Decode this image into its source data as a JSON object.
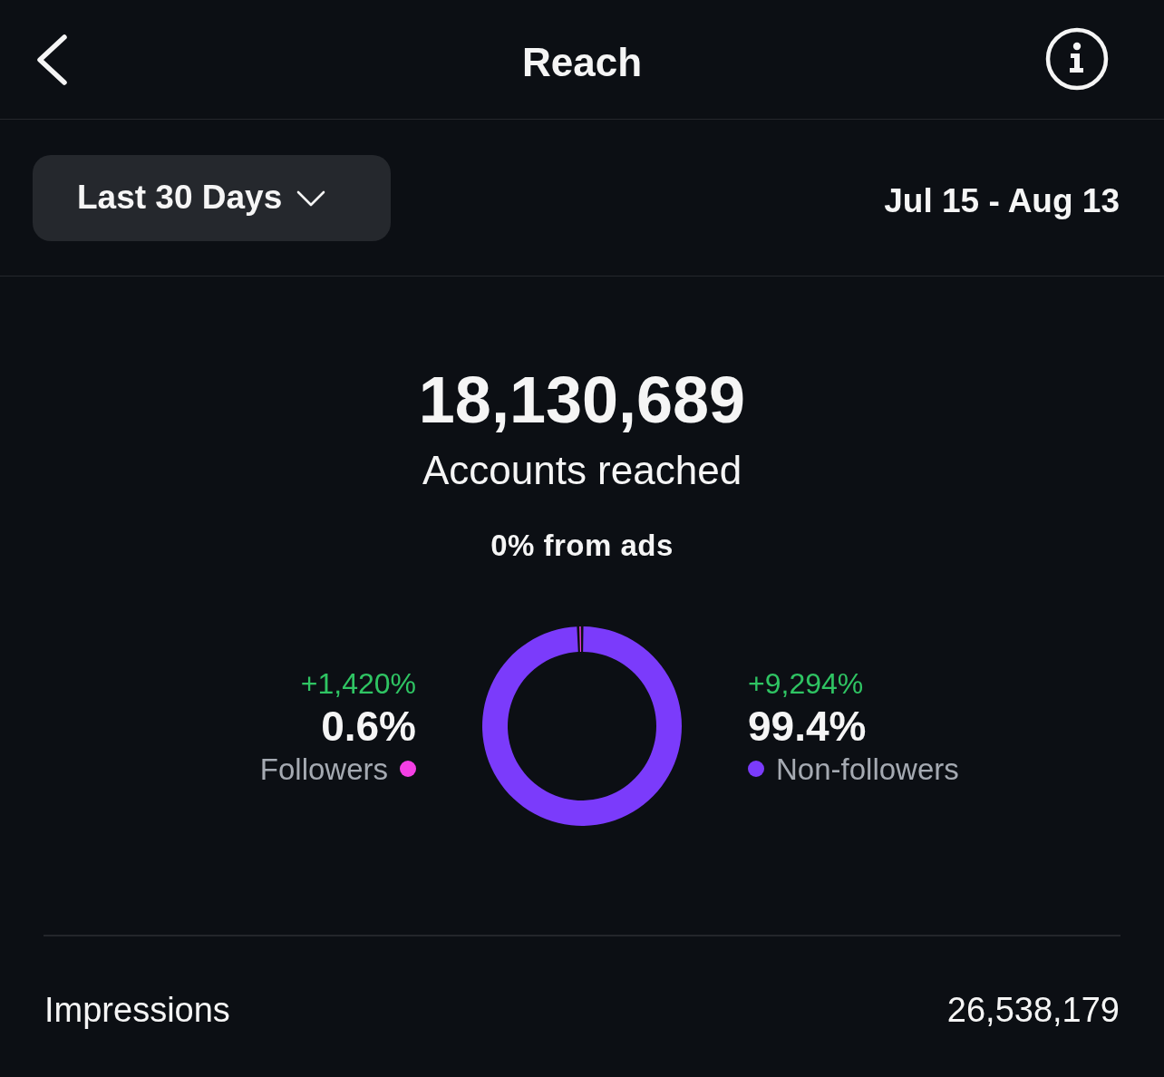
{
  "header": {
    "title": "Reach"
  },
  "filter": {
    "period": "Last 30 Days",
    "date_range": "Jul 15 - Aug 13"
  },
  "summary": {
    "value": "18,130,689",
    "label": "Accounts reached",
    "ads_share": "0% from ads"
  },
  "breakdown": {
    "chart_data": {
      "type": "donut",
      "categories": [
        "Followers",
        "Non-followers"
      ],
      "values": [
        0.6,
        99.4
      ]
    },
    "legend": [
      {
        "change": "+1,420%",
        "percent": "0.6%",
        "color": "#f43fe4"
      },
      {
        "change": "+9,294%",
        "percent": "99.4%",
        "color": "#7b3bfb"
      }
    ]
  },
  "metrics": [
    {
      "label": "Impressions",
      "value": "26,538,179"
    }
  ]
}
